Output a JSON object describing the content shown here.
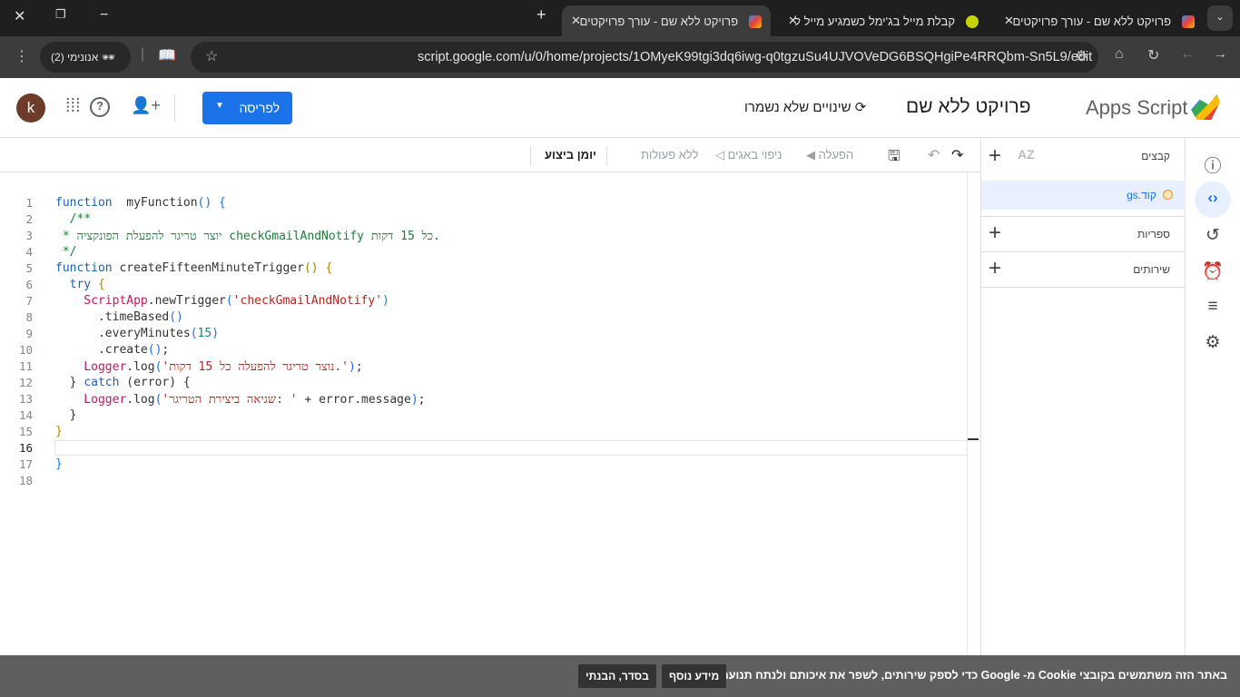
{
  "browser": {
    "tabs": [
      {
        "title": "פרויקט ללא שם - עורך פרויקטים",
        "active": false
      },
      {
        "title": "קבלת מייל בג'ימל כשמגיע מייל ל",
        "active": false
      },
      {
        "title": "פרויקט ללא שם - עורך פרויקטים",
        "active": true
      }
    ],
    "url": "script.google.com/u/0/home/projects/1OMyeK99tgi3dq6iwg-q0tgzuSu4UJVOVeDG6BSQHgiPe4RRQbm-Sn5L9/edit",
    "incognito_label": "אנונימי (2)"
  },
  "header": {
    "app_name": "Apps Script",
    "project_title": "פרויקט ללא שם",
    "save_status": "שינויים שלא נשמרו",
    "deploy_label": "לפריסה",
    "avatar_letter": "k",
    "brand_color": "#1a73e8"
  },
  "toolbar": {
    "run_label": "הפעלה",
    "debug_label": "ניפוי באגים",
    "function_select": "ללא פעולות",
    "log_label": "יומן ביצוע"
  },
  "files_panel": {
    "files_label": "קבצים",
    "sort_label": "AZ",
    "active_file": "קוד.gs",
    "libraries_label": "ספריות",
    "services_label": "שירותים"
  },
  "editor": {
    "lines": [
      [
        [
          "kw",
          "function"
        ],
        [
          "",
          "  myFunction"
        ],
        [
          "p2",
          "()"
        ],
        [
          "",
          " "
        ],
        [
          "p2",
          "{"
        ]
      ],
      [
        [
          "com",
          "  /**"
        ]
      ],
      [
        [
          "com",
          " * יוצר טריגר להפעלת הפונקציה checkGmailAndNotify כל 15 דקות."
        ]
      ],
      [
        [
          "com",
          " */"
        ]
      ],
      [
        [
          "kw",
          "function"
        ],
        [
          "",
          " createFifteenMinuteTrigger"
        ],
        [
          "p1",
          "()"
        ],
        [
          "",
          " "
        ],
        [
          "p1",
          "{"
        ]
      ],
      [
        [
          "kw",
          "  try"
        ],
        [
          "",
          " "
        ],
        [
          "p1",
          "{"
        ]
      ],
      [
        [
          "cls",
          "    ScriptApp"
        ],
        [
          "",
          ".newTrigger"
        ],
        [
          "p2",
          "("
        ],
        [
          "str",
          "'checkGmailAndNotify'"
        ],
        [
          "p2",
          ")"
        ]
      ],
      [
        [
          "",
          "      .timeBased"
        ],
        [
          "p2",
          "()"
        ]
      ],
      [
        [
          "",
          "      .everyMinutes"
        ],
        [
          "p2",
          "("
        ],
        [
          "num",
          "15"
        ],
        [
          "p2",
          ")"
        ]
      ],
      [
        [
          "",
          "      .create"
        ],
        [
          "p2",
          "()"
        ],
        [
          "",
          ";"
        ]
      ],
      [
        [
          "cls",
          "    Logger"
        ],
        [
          "",
          ".log"
        ],
        [
          "p2",
          "("
        ],
        [
          "str",
          "'נוצר טריגר להפעלה כל 15 דקות.'"
        ],
        [
          "p2",
          ")"
        ],
        [
          "",
          ";"
        ]
      ],
      [
        [
          "",
          "  } "
        ],
        [
          "kw",
          "catch"
        ],
        [
          "",
          " (error) {"
        ]
      ],
      [
        [
          "cls",
          "    Logger"
        ],
        [
          "",
          ".log"
        ],
        [
          "p2",
          "("
        ],
        [
          "str",
          "'שגיאה ביצירת הטריגר: '"
        ],
        [
          "",
          " + error.message"
        ],
        [
          "p2",
          ")"
        ],
        [
          "",
          ";"
        ]
      ],
      [
        [
          "",
          "  }"
        ]
      ],
      [
        [
          "p1",
          "}"
        ]
      ],
      [],
      [
        [
          "p2",
          "}"
        ]
      ],
      []
    ]
  },
  "cookie_banner": {
    "text": "באתר הזה משתמשים בקובצי Cookie מ- Google כדי לספק שירותים, לשפר את איכותם ולנתח תנועה.",
    "more_info": "מידע נוסף",
    "ok": "בסדר, הבנתי"
  }
}
